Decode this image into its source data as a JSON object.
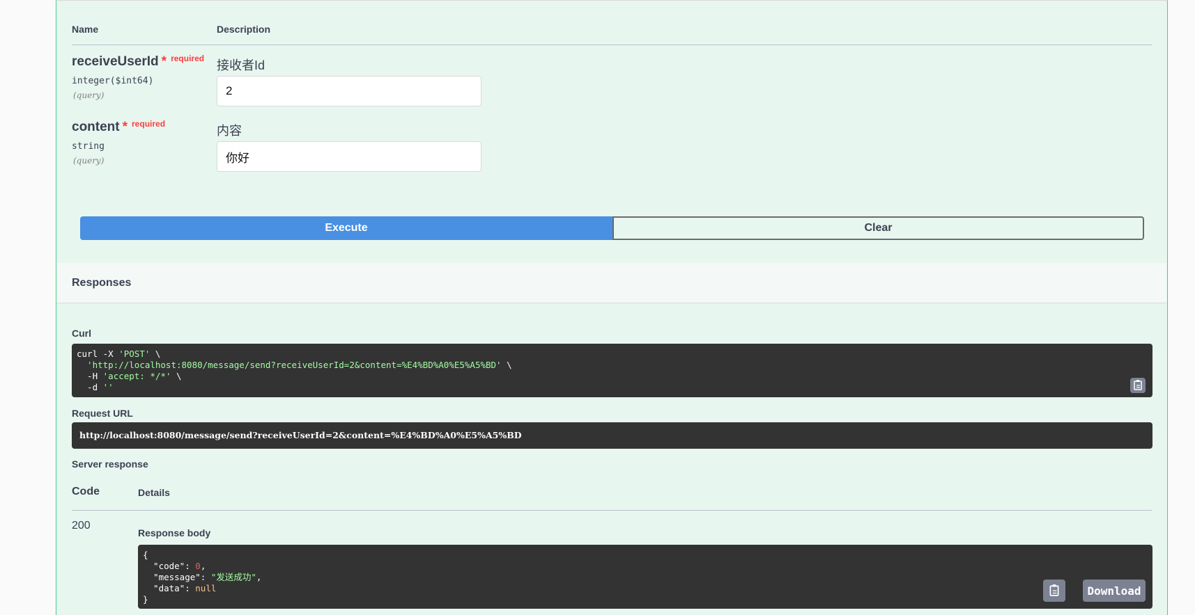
{
  "params_table": {
    "header_name": "Name",
    "header_description": "Description",
    "params": [
      {
        "name": "receiveUserId",
        "star": "*",
        "required": "required",
        "type": "integer($int64)",
        "in": "(query)",
        "description": "接收者Id",
        "value": "2"
      },
      {
        "name": "content",
        "star": "*",
        "required": "required",
        "type": "string",
        "in": "(query)",
        "description": "内容",
        "value": "你好"
      }
    ]
  },
  "buttons": {
    "execute": "Execute",
    "clear": "Clear"
  },
  "responses": {
    "title": "Responses",
    "curl_label": "Curl",
    "curl": {
      "line1_cmd": "curl -X ",
      "line1_method": "'POST'",
      "line1_end": " \\",
      "line2_url": "  'http://localhost:8080/message/send?receiveUserId=2&content=%E4%BD%A0%E5%A5%BD'",
      "line2_end": " \\",
      "line3_cmd": "  -H ",
      "line3_header": "'accept: */*'",
      "line3_end": " \\",
      "line4_cmd": "  -d ",
      "line4_data": "''"
    },
    "request_url_label": "Request URL",
    "request_url": "http://localhost:8080/message/send?receiveUserId=2&content=%E4%BD%A0%E5%A5%BD",
    "server_response_label": "Server response",
    "code_header": "Code",
    "details_header": "Details",
    "status_code": "200",
    "response_body_label": "Response body",
    "body": {
      "open": "{",
      "code_key": "  \"code\"",
      "code_val": "0",
      "message_key": "  \"message\"",
      "message_val": "\"发送成功\"",
      "data_key": "  \"data\"",
      "data_val": "null",
      "close": "}"
    },
    "download_label": "Download"
  },
  "icons": {
    "copy": "clipboard-icon"
  },
  "colors": {
    "execute_bg": "#4990e2",
    "panel_bg": "#e8f6f0",
    "panel_border": "#49cc90",
    "code_bg": "#333333"
  }
}
